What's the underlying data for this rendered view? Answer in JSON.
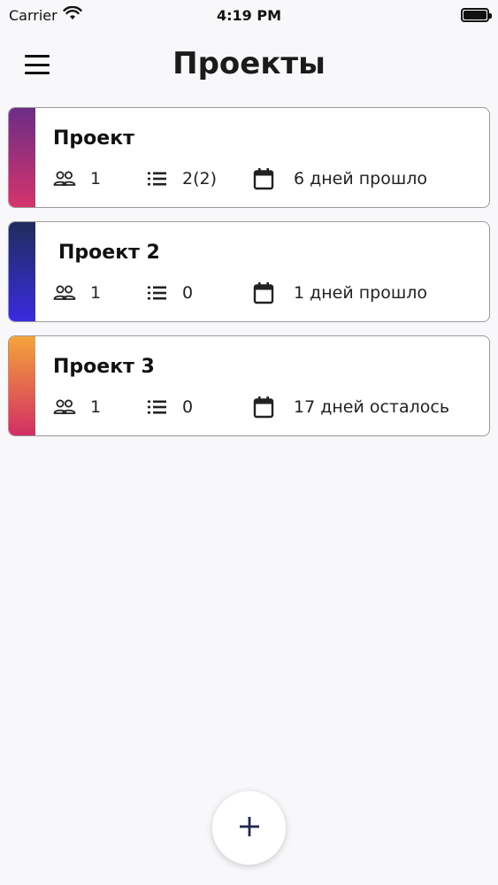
{
  "status_bar": {
    "carrier": "Carrier",
    "time": "4:19 PM"
  },
  "header": {
    "title": "Проекты",
    "menu_icon": "hamburger-menu-icon"
  },
  "projects": [
    {
      "name": "Проект",
      "members": "1",
      "tasks": "2(2)",
      "date_status": "6 дней прошло",
      "colors": [
        "#6b2d86",
        "#d6336c"
      ]
    },
    {
      "name": "Проект 2",
      "members": "1",
      "tasks": "0",
      "date_status": "1 дней прошло",
      "colors": [
        "#1f2d5c",
        "#3a2be0"
      ]
    },
    {
      "name": "Проект 3",
      "members": "1",
      "tasks": "0",
      "date_status": "17 дней осталось",
      "colors": [
        "#f4a43a",
        "#d22e63"
      ]
    }
  ],
  "fab": {
    "icon": "plus-icon"
  },
  "colors": {
    "text": "#111111",
    "fab_icon": "#1f2a4e",
    "card_border": "#9a9a9a",
    "background": "#f8f7f9"
  }
}
